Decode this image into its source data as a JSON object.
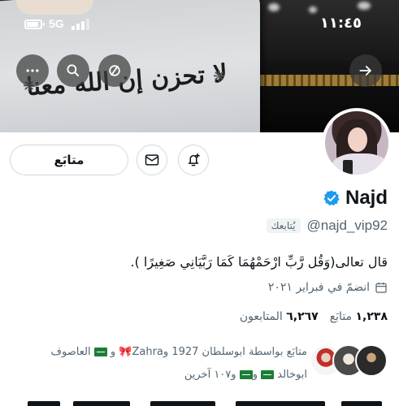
{
  "status_bar": {
    "network": "5G",
    "time": "١١:٤٥"
  },
  "banner": {
    "calligraphy": "لا تحزن إن الله معنا",
    "buttons": [
      "more-icon",
      "search-icon",
      "mute-icon",
      "forward-arrow-icon"
    ]
  },
  "actions": {
    "follow_label": "متابَع",
    "message_icon": "mail-icon",
    "notify_icon": "bell-plus-icon"
  },
  "profile": {
    "name": "Najd",
    "verified": true,
    "handle": "@najd_vip92",
    "follows_you": "يُتابعك",
    "bio": "قال تعالى(وَقُل رَّبِّ ارْحَمْهُمَا كَمَا رَبَّيَانِي صَغِيرًا ).",
    "joined": "انضمّ في فبراير ٢٠٢١",
    "following_count": "١,٢٣٨",
    "following_label": "متابَع",
    "followers_count": "٦,٢٦٧",
    "followers_label": "المتابعون"
  },
  "followed_by": {
    "prefix": "متابَع بواسطة ابوسلطان 1927 و",
    "name_zahra": "Zahra",
    "and": " و",
    "name_alasouf": " العاصوف",
    "line2_name": "ابوخالد",
    "line2_rest": " و١٠٧ آخرين"
  },
  "colors": {
    "accent": "#1d9bf0",
    "text": "#0f1419",
    "muted": "#536471",
    "border": "#cfd9de"
  }
}
